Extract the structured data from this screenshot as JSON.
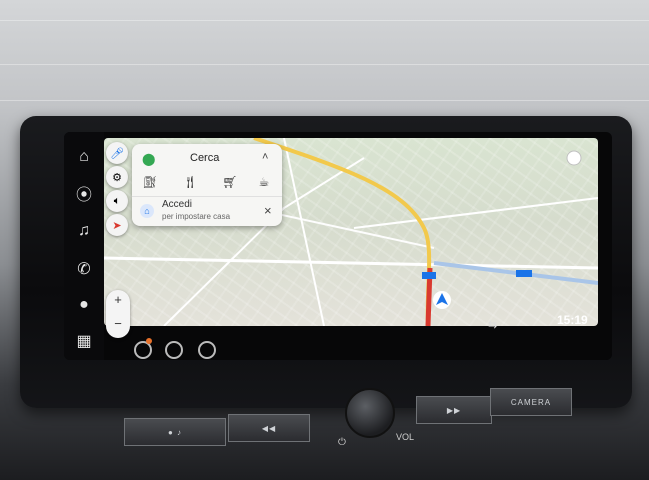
{
  "rail": {
    "icons": [
      "home-icon",
      "location-pin-icon",
      "music-note-icon",
      "phone-icon",
      "assistant-icon",
      "apps-grid-icon"
    ]
  },
  "map_controls": {
    "icons": [
      "mic-icon",
      "settings-icon",
      "volume-icon",
      "route-icon",
      "compass-icon"
    ]
  },
  "search_card": {
    "title": "Cerca",
    "categories": [
      "gas-station-icon",
      "restaurant-icon",
      "grocery-cart-icon",
      "coffee-icon"
    ],
    "home_title": "Accedi",
    "home_subtitle": "per impostare casa",
    "close": "×"
  },
  "zoom": {
    "plus": "+",
    "minus": "−"
  },
  "status": {
    "clock": "15:19"
  },
  "physical": {
    "volume_label": "VOL",
    "camera_label": "CAMERA"
  },
  "colors": {
    "route": "#d9392f",
    "map_accent": "#1a73e8"
  }
}
